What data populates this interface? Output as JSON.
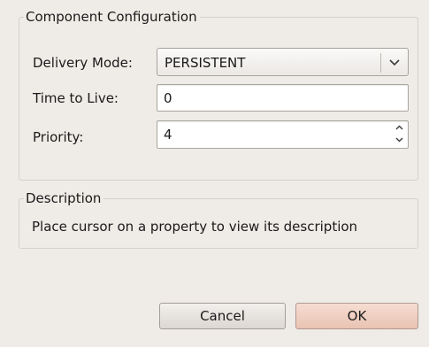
{
  "dialog": {
    "config_group": {
      "title": "Component Configuration",
      "delivery_mode": {
        "label": "Delivery Mode:",
        "value": "PERSISTENT",
        "arrow_icon": "chevron-down-icon"
      },
      "time_to_live": {
        "label": "Time to Live:",
        "value": "0"
      },
      "priority": {
        "label": "Priority:",
        "value": "4",
        "up_icon": "spin-up-icon",
        "down_icon": "spin-down-icon"
      }
    },
    "description_group": {
      "title": "Description",
      "text": "Place cursor on a property to view its description"
    },
    "buttons": {
      "cancel": "Cancel",
      "ok": "OK"
    }
  },
  "colors": {
    "background": "#efebe7",
    "ok_button": "#eccabc",
    "border": "#d4d0cb"
  }
}
